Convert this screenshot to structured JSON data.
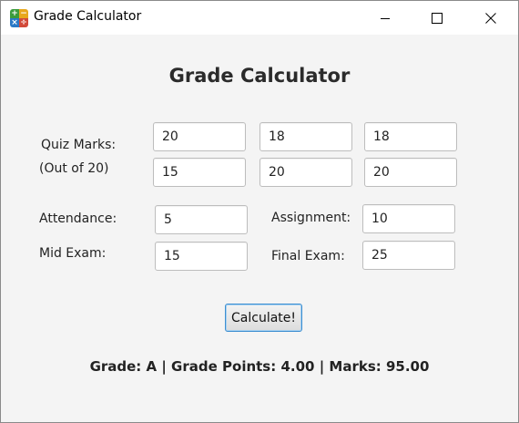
{
  "window": {
    "title": "Grade Calculator",
    "icon_name": "calculator-app-icon"
  },
  "main": {
    "heading": "Grade Calculator",
    "quiz_label_line1": "Quiz Marks:",
    "quiz_label_line2": "(Out of 20)",
    "quiz_values": [
      "20",
      "18",
      "18",
      "15",
      "20",
      "20"
    ],
    "attendance_label": "Attendance:",
    "attendance_value": "5",
    "assignment_label": "Assignment:",
    "assignment_value": "10",
    "mid_exam_label": "Mid Exam:",
    "mid_exam_value": "15",
    "final_exam_label": "Final Exam:",
    "final_exam_value": "25",
    "calculate_label": "Calculate!",
    "result_text": "Grade: A | Grade Points: 4.00 | Marks: 95.00"
  },
  "colors": {
    "button_focus_border": "#3d8fd1",
    "background": "#f4f4f4"
  }
}
